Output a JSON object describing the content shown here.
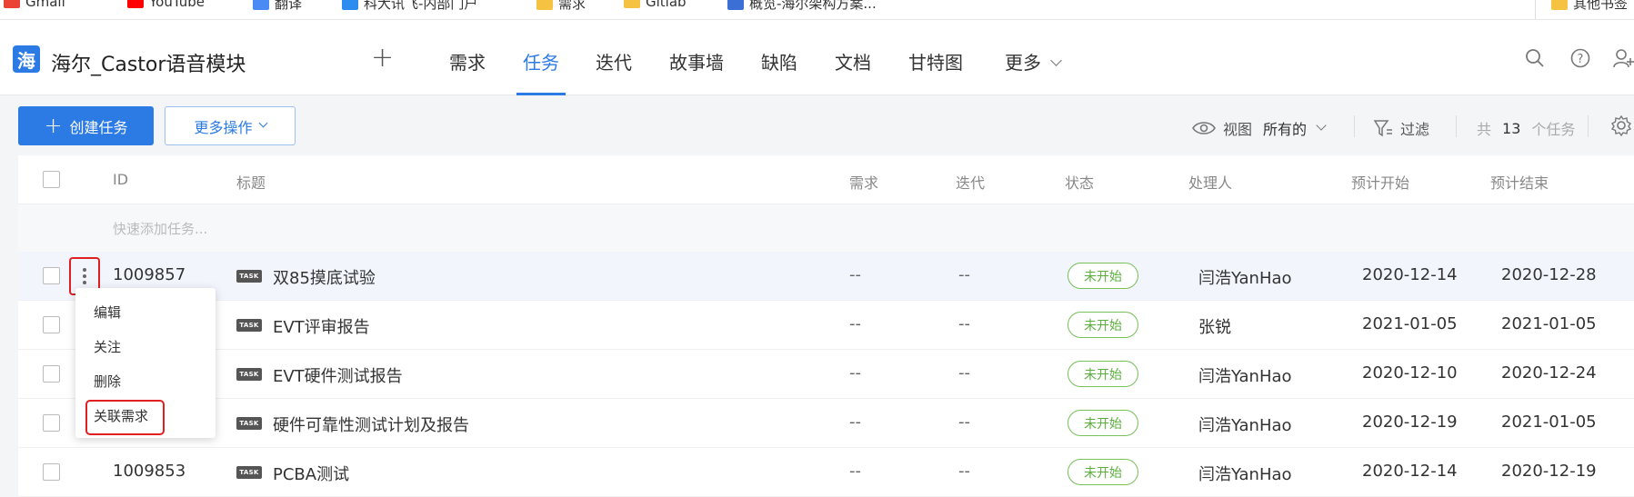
{
  "bookmarks": [
    {
      "label": "Gmail",
      "color": "#ea4335"
    },
    {
      "label": "YouTube",
      "color": "#ff0000"
    },
    {
      "label": "翻译",
      "color": "#4a8af4"
    },
    {
      "label": "科大讯飞-内部门户",
      "color": "#2d8cf0"
    },
    {
      "label": "需求",
      "color": "#f5c242"
    },
    {
      "label": "Gitlab",
      "color": "#f5c242"
    },
    {
      "label": "概览-海尔架构方案...",
      "color": "#3b6fd6"
    },
    {
      "label": "其他书签",
      "color": "#f5c242"
    }
  ],
  "project": {
    "logo": "海",
    "name": "海尔_Castor语音模块"
  },
  "nav": {
    "add": "+",
    "tabs": [
      "需求",
      "任务",
      "迭代",
      "故事墙",
      "缺陷",
      "文档",
      "甘特图",
      "更多"
    ],
    "active_index": 1
  },
  "header_icons": [
    "search-icon",
    "help-icon",
    "user-add-icon"
  ],
  "toolbar": {
    "create_label": "创建任务",
    "more_label": "更多操作",
    "view_label": "视图",
    "view_value": "所有的",
    "filter_label": "过滤",
    "count_prefix": "共",
    "count_value": "13",
    "count_suffix": "个任务"
  },
  "table": {
    "headers": [
      "ID",
      "标题",
      "需求",
      "迭代",
      "状态",
      "处理人",
      "预计开始",
      "预计结束"
    ],
    "quick_add_placeholder": "快速添加任务...",
    "task_badge": "TASK",
    "rows": [
      {
        "id": "1009857",
        "title": "双85摸底试验",
        "req": "--",
        "iter": "--",
        "status": "未开始",
        "owner": "闫浩YanHao",
        "start": "2020-12-14",
        "end": "2020-12-28"
      },
      {
        "id": "",
        "title": "EVT评审报告",
        "req": "--",
        "iter": "--",
        "status": "未开始",
        "owner": "张锐",
        "start": "2021-01-05",
        "end": "2021-01-05"
      },
      {
        "id": "",
        "title": "EVT硬件测试报告",
        "req": "--",
        "iter": "--",
        "status": "未开始",
        "owner": "闫浩YanHao",
        "start": "2020-12-10",
        "end": "2020-12-24"
      },
      {
        "id": "",
        "title": "硬件可靠性测试计划及报告",
        "req": "--",
        "iter": "--",
        "status": "未开始",
        "owner": "闫浩YanHao",
        "start": "2020-12-19",
        "end": "2021-01-05"
      },
      {
        "id": "1009853",
        "title": "PCBA测试",
        "req": "--",
        "iter": "--",
        "status": "未开始",
        "owner": "闫浩YanHao",
        "start": "2020-12-14",
        "end": "2020-12-19"
      }
    ]
  },
  "context_menu": {
    "items": [
      "编辑",
      "关注",
      "删除",
      "关联需求"
    ],
    "highlighted_index": 3
  },
  "colors": {
    "accent": "#2c7be5",
    "status_green": "#5aae3b",
    "annotation_red": "#e02020"
  }
}
